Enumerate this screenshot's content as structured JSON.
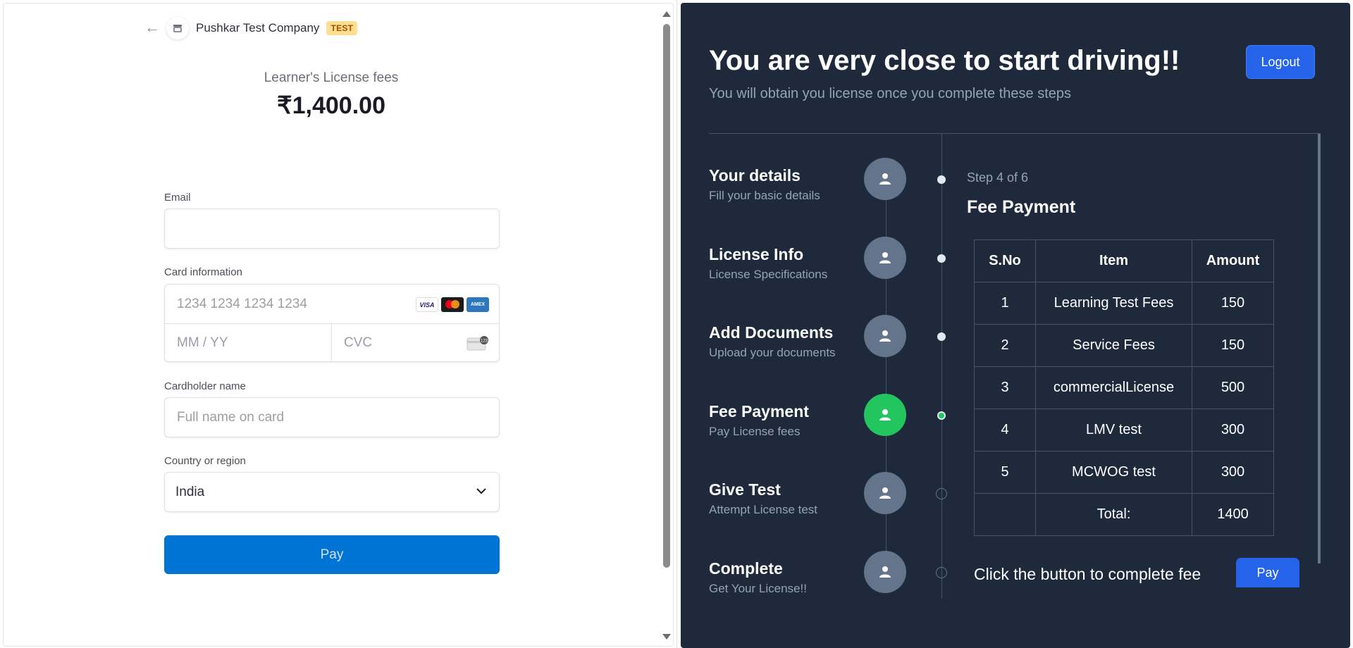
{
  "checkout": {
    "company": "Pushkar Test Company",
    "badge": "TEST",
    "fee_label": "Learner's License fees",
    "fee_amount": "₹1,400.00",
    "email_label": "Email",
    "email_value": "",
    "card_label": "Card information",
    "card_number_placeholder": "1234 1234 1234 1234",
    "expiry_placeholder": "MM / YY",
    "cvc_placeholder": "CVC",
    "cardholder_label": "Cardholder name",
    "cardholder_placeholder": "Full name on card",
    "country_label": "Country or region",
    "country_value": "India",
    "pay_label": "Pay",
    "brands": [
      "VISA",
      "mastercard",
      "AMEX"
    ]
  },
  "portal": {
    "title": "You are very close to start driving!!",
    "subtitle": "You will obtain you license once you complete these steps",
    "logout_label": "Logout",
    "steps": [
      {
        "name": "Your details",
        "desc": "Fill your basic details",
        "status": "done"
      },
      {
        "name": "License Info",
        "desc": "License Specifications",
        "status": "done"
      },
      {
        "name": "Add Documents",
        "desc": "Upload your documents",
        "status": "done"
      },
      {
        "name": "Fee Payment",
        "desc": "Pay License fees",
        "status": "active"
      },
      {
        "name": "Give Test",
        "desc": "Attempt License test",
        "status": "pending"
      },
      {
        "name": "Complete",
        "desc": "Get Your License!!",
        "status": "pending"
      }
    ],
    "step_counter": "Step 4 of 6",
    "step_heading": "Fee Payment",
    "table": {
      "headers": [
        "S.No",
        "Item",
        "Amount"
      ],
      "rows": [
        [
          "1",
          "Learning Test Fees",
          "150"
        ],
        [
          "2",
          "Service Fees",
          "150"
        ],
        [
          "3",
          "commercialLicense",
          "500"
        ],
        [
          "4",
          "LMV test",
          "300"
        ],
        [
          "5",
          "MCWOG test",
          "300"
        ]
      ],
      "total_label": "Total:",
      "total_value": "1400"
    },
    "complete_text": "Click the button to complete fee",
    "pay_label": "Pay",
    "colors": {
      "panel": "#1e293b",
      "accent": "#2563eb",
      "active": "#22c55e",
      "stripe_pay": "#0074d4"
    }
  }
}
